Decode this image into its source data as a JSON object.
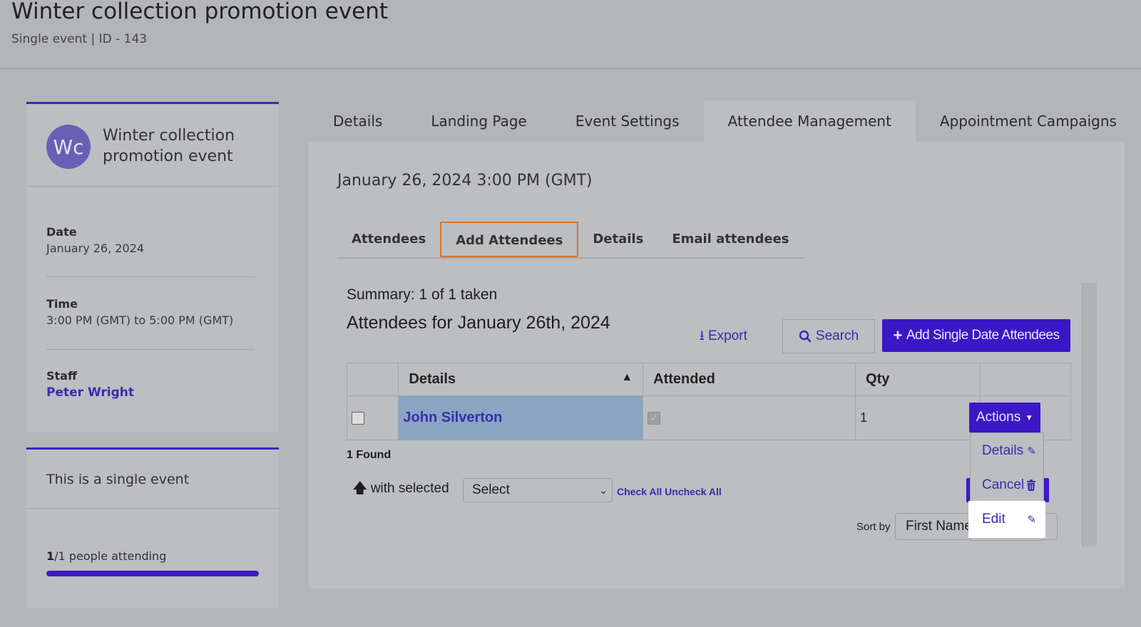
{
  "header": {
    "title": "Winter collection promotion event",
    "subtitle": "Single event | ID - 143"
  },
  "event_card": {
    "avatar_initials": "Wc",
    "name": "Winter collection promotion event",
    "date_label": "Date",
    "date_value": "January 26, 2024",
    "time_label": "Time",
    "time_value": "3:00 PM (GMT) to 5:00 PM (GMT)",
    "staff_label": "Staff",
    "staff_value": "Peter Wright"
  },
  "status_card": {
    "type_text": "This is a single event",
    "attending_count": "1",
    "attending_rest": "/1 people attending",
    "attending_fraction": 1.0
  },
  "top_tabs": [
    {
      "label": "Details",
      "active": false
    },
    {
      "label": "Landing Page",
      "active": false
    },
    {
      "label": "Event Settings",
      "active": false
    },
    {
      "label": "Attendee Management",
      "active": true
    },
    {
      "label": "Appointment Campaigns",
      "active": false
    }
  ],
  "main": {
    "datetime": "January 26, 2024 3:00 PM (GMT)",
    "subtabs": [
      {
        "label": "Attendees",
        "active": false
      },
      {
        "label": "Add Attendees",
        "active": true
      },
      {
        "label": "Details",
        "active": false
      },
      {
        "label": "Email attendees",
        "active": false
      }
    ],
    "summary": "Summary: 1 of 1 taken",
    "heading": "Attendees for January 26th, 2024",
    "export_label": "Export",
    "search_label": "Search",
    "add_label": "Add Single Date Attendees",
    "table": {
      "headers": [
        "",
        "Details",
        "Attended",
        "Qty",
        ""
      ],
      "rows": [
        {
          "name": "John Silverton",
          "attended": true,
          "qty": "1"
        }
      ]
    },
    "actions_label": "Actions",
    "found_text": "1 Found",
    "with_selected": "with selected",
    "bulk_select_value": "Select",
    "check_all": "Check All",
    "uncheck_all": "Uncheck All",
    "sort_label": "Sort by",
    "sort_value": "First Name, L"
  },
  "actions_menu": {
    "items": [
      {
        "label": "Details",
        "icon": "pencil-icon"
      },
      {
        "label": "Cancel",
        "icon": "trash-icon"
      },
      {
        "label": "Edit",
        "icon": "pencil-icon"
      }
    ]
  },
  "colors": {
    "accent": "#3a18c6",
    "link": "#3a2bb0",
    "subtab_active_border": "#d6732c",
    "selected_cell": "#8aa4c4"
  }
}
